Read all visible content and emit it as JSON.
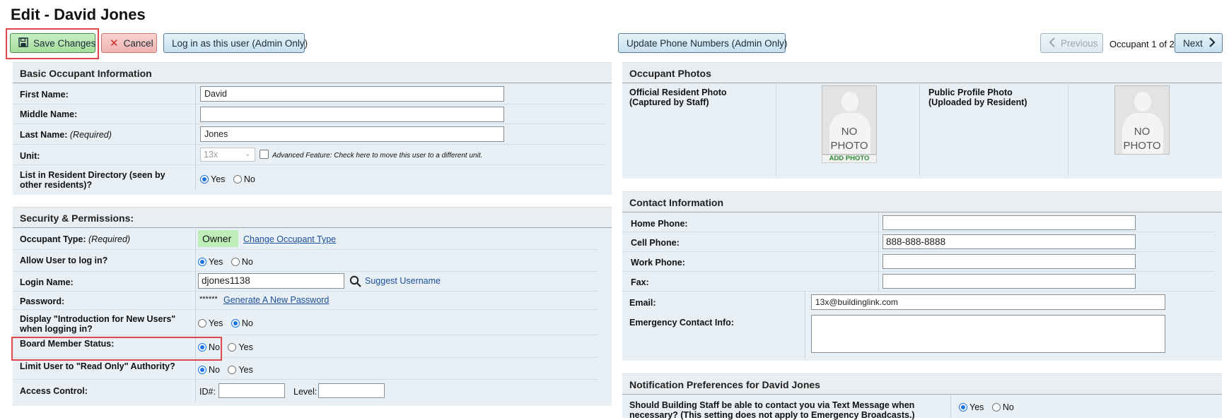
{
  "page": {
    "title": "Edit - David Jones"
  },
  "toolbar": {
    "save_label": "Save Changes",
    "cancel_label": "Cancel",
    "login_as_label": "Log in as this user (Admin Only)",
    "update_phone_label": "Update Phone Numbers (Admin Only)",
    "previous_label": "Previous",
    "occupant_counter": "Occupant 1 of 2",
    "next_label": "Next"
  },
  "basic_info": {
    "heading": "Basic Occupant Information",
    "first_name_label": "First Name:",
    "first_name_value": "David",
    "middle_name_label": "Middle Name:",
    "middle_name_value": "",
    "last_name_label": "Last Name:",
    "last_name_required": "(Required)",
    "last_name_value": "Jones",
    "unit_label": "Unit:",
    "unit_value": "13x",
    "unit_note": "Advanced Feature: Check here to move this user to a different unit.",
    "directory_label": "List in Resident Directory (seen by other residents)?",
    "directory_yes": "Yes",
    "directory_no": "No"
  },
  "security": {
    "heading": "Security & Permissions:",
    "occupant_type_label": "Occupant Type:",
    "occupant_type_required": "(Required)",
    "occupant_type_value": "Owner",
    "change_type_link": "Change Occupant Type",
    "allow_login_label": "Allow User to log in?",
    "yes": "Yes",
    "no": "No",
    "login_name_label": "Login Name:",
    "login_name_value": "djones1138",
    "suggest_username": "Suggest Username",
    "password_label": "Password:",
    "password_mask": "******",
    "generate_password_link": "Generate A New Password",
    "intro_label": "Display \"Introduction for New Users\" when logging in?",
    "board_label": "Board Member Status:",
    "readonly_label": "Limit User to \"Read Only\" Authority?",
    "access_label": "Access Control:",
    "access_id_label": "ID#:",
    "access_level_label": "Level:"
  },
  "photos": {
    "heading": "Occupant Photos",
    "official_label": "Official Resident Photo (Captured by Staff)",
    "public_label": "Public Profile Photo (Uploaded by Resident)",
    "no_photo_1": "NO",
    "no_photo_2": "PHOTO",
    "add_photo": "ADD PHOTO"
  },
  "contact": {
    "heading": "Contact Information",
    "home_label": "Home Phone:",
    "home_value": "",
    "cell_label": "Cell Phone:",
    "cell_value": "888-888-8888",
    "work_label": "Work Phone:",
    "work_value": "",
    "fax_label": "Fax:",
    "fax_value": "",
    "email_label": "Email:",
    "email_value": "13x@buildinglink.com",
    "emergency_label": "Emergency Contact Info:",
    "emergency_value": ""
  },
  "notifications": {
    "heading": "Notification Preferences for David Jones",
    "text_msg_label": "Should Building Staff be able to contact you via Text Message when necessary? (This setting does not apply to Emergency Broadcasts.)",
    "yes": "Yes",
    "no": "No"
  },
  "colors": {
    "highlight": "#e0474c",
    "owner_badge": "#bfeeb9",
    "link": "#1a4f9c"
  }
}
